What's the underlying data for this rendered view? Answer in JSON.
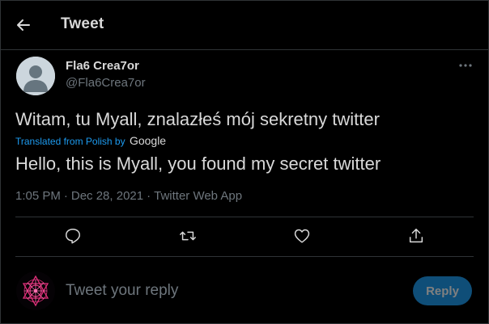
{
  "header": {
    "title": "Tweet",
    "back_icon": "arrow-left-icon"
  },
  "author": {
    "name": "Fla6 Crea7or",
    "handle": "@Fla6Crea7or",
    "avatar": "default-avatar"
  },
  "tweet": {
    "text": "Witam, tu Myall, znalazłeś mój sekretny twitter",
    "translated_label": "Translated from Polish by",
    "translator": "Google",
    "translated_text": "Hello, this is Myall, you found my secret twitter",
    "time": "1:05 PM",
    "sep": "·",
    "date": "Dec 28, 2021",
    "source": "Twitter Web App"
  },
  "actions": [
    "reply-icon",
    "retweet-icon",
    "like-icon",
    "share-icon"
  ],
  "composer": {
    "placeholder": "Tweet your reply",
    "button": "Reply"
  },
  "colors": {
    "background": "#000000",
    "text": "#d9d9d9",
    "secondary": "#6e767d",
    "accent": "#1d9bf0",
    "divider": "#2f3336",
    "reply_button": "#0f4e78"
  }
}
